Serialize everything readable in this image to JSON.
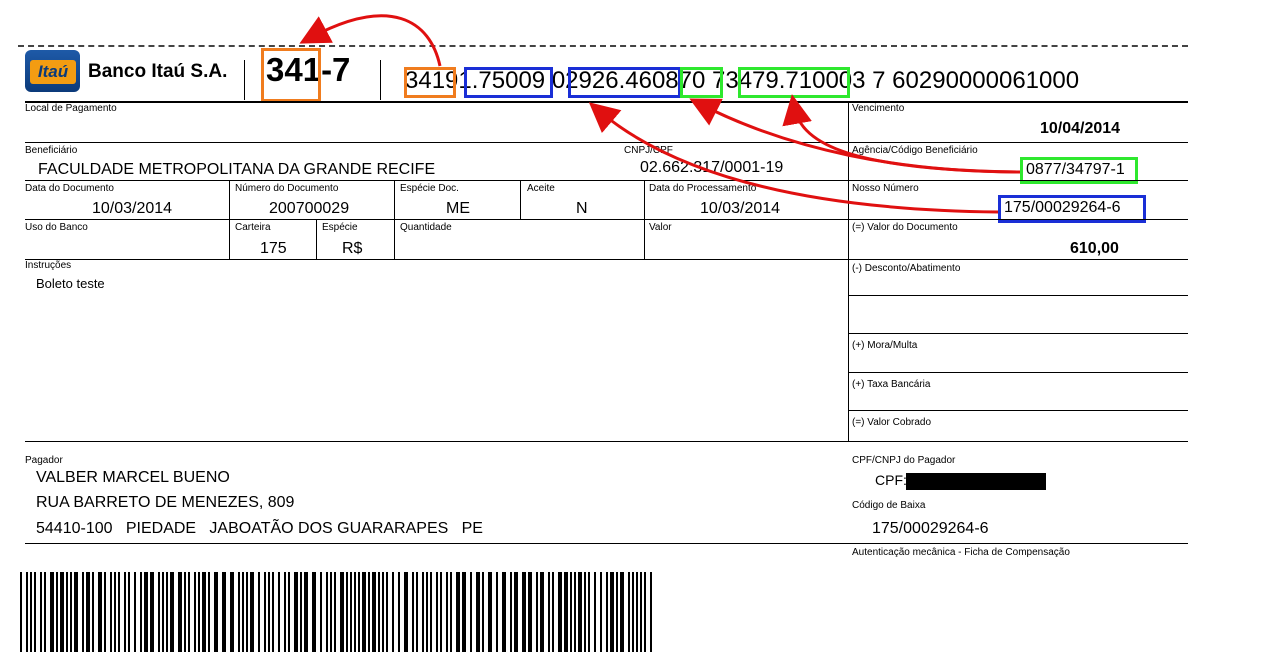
{
  "header": {
    "logo_text": "Itaú",
    "bank_name": "Banco Itaú S.A.",
    "bank_code": "341",
    "bank_code_suffix": "-7",
    "digitable_line": {
      "p1": "3419",
      "p2": "1.7500",
      "p3": "9",
      "p4": "02926.46",
      "p5": "0870",
      "p6": "73479.71",
      "p7": "0003 7 60290000061000"
    }
  },
  "fields": {
    "local_pagamento_label": "Local de Pagamento",
    "vencimento_label": "Vencimento",
    "vencimento": "10/04/2014",
    "beneficiario_label": "Beneficiário",
    "beneficiario": "FACULDADE METROPOLITANA DA GRANDE RECIFE",
    "cnpj_label": "CNPJ/CPF",
    "cnpj": "02.662.317/0001-19",
    "agencia_label": "Agência/Código Beneficiário",
    "agencia": "0877/34797-1",
    "data_doc_label": "Data do Documento",
    "data_doc": "10/03/2014",
    "num_doc_label": "Número do Documento",
    "num_doc": "200700029",
    "especie_doc_label": "Espécie Doc.",
    "especie_doc": "ME",
    "aceite_label": "Aceite",
    "aceite": "N",
    "data_proc_label": "Data do Processamento",
    "data_proc": "10/03/2014",
    "nosso_numero_label": "Nosso Número",
    "nosso_numero": "175/00029264-6",
    "uso_banco_label": "Uso do Banco",
    "carteira_label": "Carteira",
    "carteira": "175",
    "especie_label": "Espécie",
    "especie": "R$",
    "quantidade_label": "Quantidade",
    "valor_label": "Valor",
    "valor_doc_label": "(=) Valor do Documento",
    "valor_doc": "610,00",
    "instrucoes_label": "Instruções",
    "instrucoes": "Boleto teste",
    "desconto_label": "(-) Desconto/Abatimento",
    "mora_label": "(+) Mora/Multa",
    "taxa_label": "(+) Taxa Bancária",
    "valor_cobrado_label": "(=) Valor Cobrado",
    "pagador_label": "Pagador",
    "pagador_nome": "VALBER MARCEL BUENO",
    "pagador_endereco": "RUA BARRETO DE MENEZES, 809",
    "pagador_cidade": "54410-100   PIEDADE   JABOATÃO DOS GUARARAPES   PE",
    "cpf_label": "CPF/CNPJ do Pagador",
    "cpf_prefix": "CPF:",
    "cod_baixa_label": "Código de Baixa",
    "cod_baixa": "175/00029264-6",
    "autenticacao_label": "Autenticação mecânica - Ficha de Compensação"
  },
  "colors": {
    "orange": "#f07c1e",
    "blue": "#1a2fd6",
    "green": "#2ee82e",
    "arrow_red": "#e01010"
  }
}
